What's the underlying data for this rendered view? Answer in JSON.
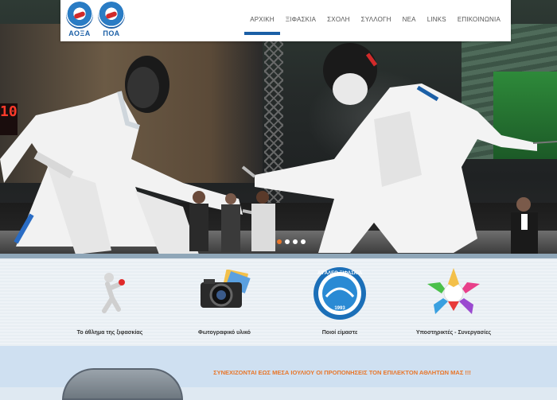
{
  "logos": [
    {
      "name": "ΑΟΞΑ"
    },
    {
      "name": "ΠΟΑ"
    }
  ],
  "nav": {
    "items": [
      {
        "label": "ΑΡΧΙΚΗ",
        "active": true
      },
      {
        "label": "ΞΙΦΑΣΚΙΑ"
      },
      {
        "label": "ΣΧΟΛΗ"
      },
      {
        "label": "ΣΥΛΛΟΓΗ"
      },
      {
        "label": "ΝΕΑ"
      },
      {
        "label": "LINKS"
      },
      {
        "label": "ΕΠΙΚΟΙΝΩΝΙΑ"
      }
    ]
  },
  "hero": {
    "scoreboard_text": "10",
    "slides_count": 4,
    "active_slide": 1
  },
  "features": [
    {
      "label": "Το άθλημα της ξιφασκίας",
      "icon": "fencer-figure-icon"
    },
    {
      "label": "Φωτογραφικό υλικό",
      "icon": "camera-icon"
    },
    {
      "label": "Ποιοί είμαστε",
      "icon": "club-emblem-icon",
      "emblem_text": "ΑΙΓΑΛΕΩ ΞΙΦΑΣΚΙΑ",
      "emblem_year": "1993"
    },
    {
      "label": "Υποστηρικτές - Συνεργασίες",
      "icon": "partners-star-icon"
    }
  ],
  "announcement": {
    "text": "ΣΥΝΕΧΙΖΟΝΤΑΙ ΕΩΣ ΜΕΣΑ ΙΟΥΛΙΟΥ ΟΙ ΠΡΟΠΟΝΗΣΕΙΣ ΤΟΝ ΕΠΙΛΕΚΤΟΝ ΑΘΛΗΤΩΝ ΜΑΣ !!!"
  },
  "colors": {
    "brand_blue": "#1b5fa6",
    "accent_orange": "#e8762a",
    "features_bg": "#eef3f7",
    "bottom_bg": "#cfe0f1"
  }
}
